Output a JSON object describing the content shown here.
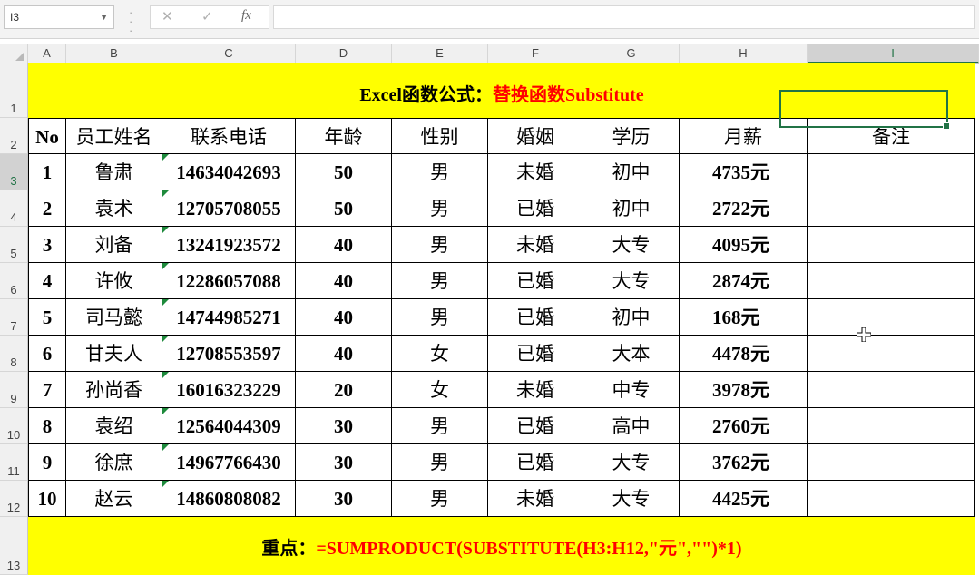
{
  "formula_bar": {
    "name_box": "I3",
    "cancel_glyph": "✕",
    "enter_glyph": "✓",
    "fx_label": "fx",
    "formula": ""
  },
  "columns": [
    "A",
    "B",
    "C",
    "D",
    "E",
    "F",
    "G",
    "H",
    "I"
  ],
  "selected_column": "I",
  "rows": [
    "1",
    "2",
    "3",
    "4",
    "5",
    "6",
    "7",
    "8",
    "9",
    "10",
    "11",
    "12",
    "13"
  ],
  "selected_row": "3",
  "title": {
    "prefix": "Excel函数公式：",
    "highlight": "替换函数Substitute"
  },
  "headers": [
    "No",
    "员工姓名",
    "联系电话",
    "年龄",
    "性别",
    "婚姻",
    "学历",
    "月薪",
    "备注"
  ],
  "records": [
    [
      "1",
      "鲁肃",
      "14634042693",
      "50",
      "男",
      "未婚",
      "初中",
      "4735元",
      ""
    ],
    [
      "2",
      "袁术",
      "12705708055",
      "50",
      "男",
      "已婚",
      "初中",
      "2722元",
      ""
    ],
    [
      "3",
      "刘备",
      "13241923572",
      "40",
      "男",
      "未婚",
      "大专",
      "4095元",
      ""
    ],
    [
      "4",
      "许攸",
      "12286057088",
      "40",
      "男",
      "已婚",
      "大专",
      "2874元",
      ""
    ],
    [
      "5",
      "司马懿",
      "14744985271",
      "40",
      "男",
      "已婚",
      "初中",
      "168元",
      ""
    ],
    [
      "6",
      "甘夫人",
      "12708553597",
      "40",
      "女",
      "已婚",
      "大本",
      "4478元",
      ""
    ],
    [
      "7",
      "孙尚香",
      "16016323229",
      "20",
      "女",
      "未婚",
      "中专",
      "3978元",
      ""
    ],
    [
      "8",
      "袁绍",
      "12564044309",
      "30",
      "男",
      "已婚",
      "高中",
      "2760元",
      ""
    ],
    [
      "9",
      "徐庶",
      "14967766430",
      "30",
      "男",
      "已婚",
      "大专",
      "3762元",
      ""
    ],
    [
      "10",
      "赵云",
      "14860808082",
      "30",
      "男",
      "未婚",
      "大专",
      "4425元",
      ""
    ]
  ],
  "footer": {
    "prefix": "重点：",
    "formula": "=SUMPRODUCT(SUBSTITUTE(H3:H12,\"元\",\"\")*1)"
  },
  "colors": {
    "band": "#ffff00",
    "accent_red": "#ff0000",
    "excel_green": "#217346"
  }
}
